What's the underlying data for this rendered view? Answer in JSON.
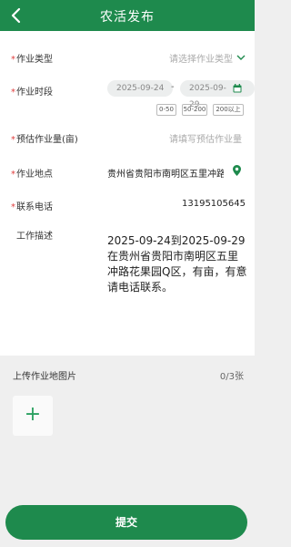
{
  "header": {
    "title": "农活发布"
  },
  "form": {
    "work_type": {
      "label": "作业类型",
      "placeholder": "请选择作业类型"
    },
    "work_period": {
      "label": "作业时段",
      "start_date": "2025-09-24",
      "separator": "-",
      "end_date": "2025-09-29",
      "quick_options": [
        "0-50",
        "50-200",
        "200以上"
      ]
    },
    "estimated_amount": {
      "label": "预估作业量(亩)",
      "placeholder": "请填写预估作业量"
    },
    "location": {
      "label": "作业地点",
      "value": "贵州省贵阳市南明区五里冲路"
    },
    "phone": {
      "label": "联系电话",
      "value": "13195105645"
    },
    "description": {
      "label": "工作描述",
      "value": "2025-09-24到2025-09-29在贵州省贵阳市南明区五里冲路花果园Q区，有亩，有意请电话联系。"
    },
    "required_mark": "*"
  },
  "upload": {
    "label": "上传作业地图片",
    "count": "0/3张",
    "add_symbol": "+"
  },
  "submit": {
    "label": "提交"
  },
  "colors": {
    "primary": "#1e8a4d",
    "required": "#e04040",
    "accent": "#2aa060"
  },
  "icons": [
    "back-arrow-icon",
    "chevron-down-icon",
    "calendar-icon",
    "location-pin-icon",
    "plus-icon"
  ]
}
